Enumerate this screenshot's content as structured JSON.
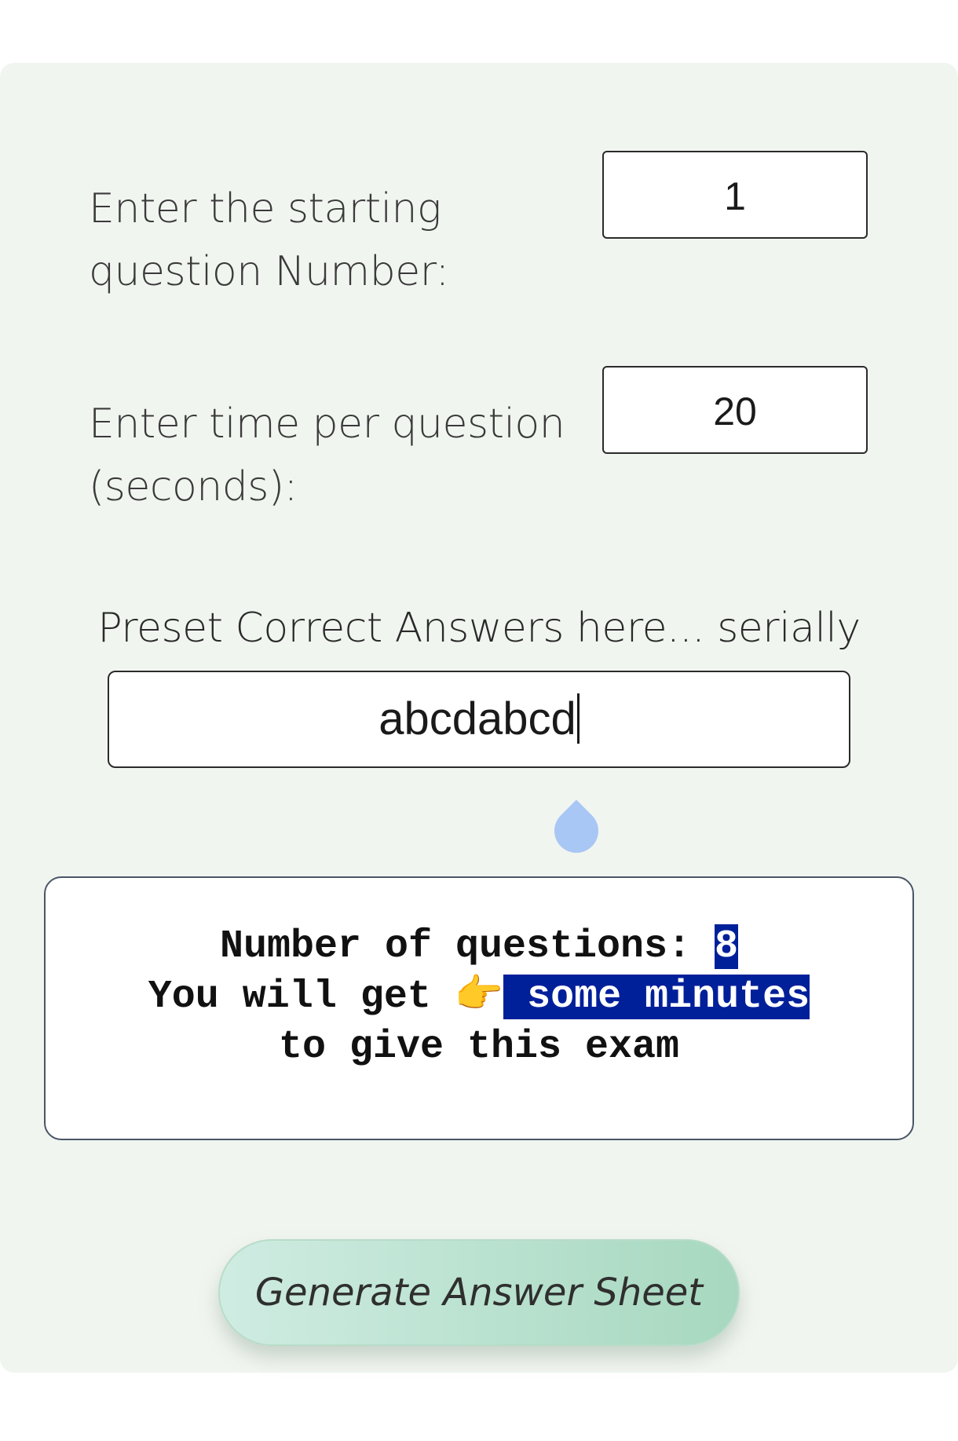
{
  "form": {
    "start_label": "Enter the starting question Number:",
    "start_value": "1",
    "time_label": "Enter time per question (seconds):",
    "time_value": "20",
    "preset_label": "Preset Correct Answers here... serially",
    "preset_value": "abcdabcd"
  },
  "info": {
    "count_prefix": "Number of questions: ",
    "count_value": "8",
    "line2_prefix": "You will get ",
    "pointing_emoji": "👉",
    "time_highlight": " some minutes",
    "line3": "to give this exam"
  },
  "button": {
    "label": "Generate Answer Sheet"
  },
  "colors": {
    "card_bg": "#f1f5f0",
    "highlight": "#00209a",
    "button_gradient_start": "#cfece2",
    "button_gradient_end": "#a7d8bf",
    "caret_handle": "#a9c7f5"
  },
  "icons": {
    "pointing": "pointing-right-hand-icon",
    "caret_handle": "text-selection-handle-icon"
  }
}
